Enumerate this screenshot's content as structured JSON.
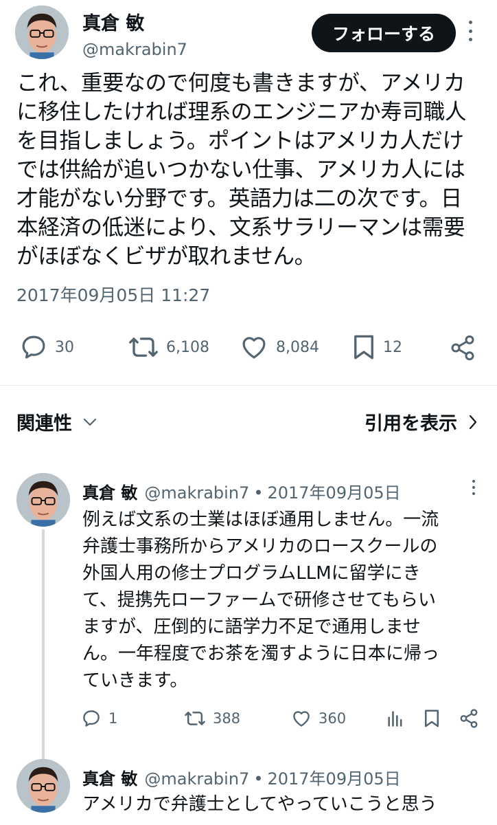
{
  "tweet": {
    "author_name": "真倉 敏",
    "author_handle": "@makrabin7",
    "follow_label": "フォローする",
    "text": "これ、重要なので何度も書きますが、アメリカ\nに移住したければ理系のエンジニアか寿司職人\nを目指しましょう。ポイントはアメリカ人だけ\nでは供給が追いつかない仕事、アメリカ人には\n才能がない分野です。英語力は二の次です。日\n本経済の低迷により、文系サラリーマンは需要\nがほぼなくビザが取れません。",
    "timestamp": "2017年09月05日 11:27",
    "stats": {
      "replies": "30",
      "retweets": "6,108",
      "likes": "8,084",
      "bookmarks": "12"
    }
  },
  "section": {
    "related_label": "関連性",
    "quotes_label": "引用を表示"
  },
  "replies": [
    {
      "author_name": "真倉 敏",
      "author_handle": "@makrabin7",
      "separator": "•",
      "date": "2017年09月05日",
      "text": "例えば文系の士業はほぼ通用しません。一流\n弁護士事務所からアメリカのロースクールの\n外国人用の修士プログラムLLMに留学にき\nて、提携先ローファームで研修させてもらい\nますが、圧倒的に語学力不足で通用しませ\nん。一年程度でお茶を濁すように日本に帰っ\nていきます。",
      "stats": {
        "replies": "1",
        "retweets": "388",
        "likes": "360"
      }
    },
    {
      "author_name": "真倉 敏",
      "author_handle": "@makrabin7",
      "separator": "•",
      "date": "2017年09月05日",
      "text": "アメリカで弁護士としてやっていこうと思う"
    }
  ],
  "icons": {
    "reply": "comment-icon",
    "retweet": "retweet-icon",
    "like": "heart-icon",
    "bookmark": "bookmark-icon",
    "share": "share-icon",
    "views": "bar-chart-icon",
    "more": "more-dots-icon"
  },
  "colors": {
    "text": "#0f1419",
    "secondary": "#536471",
    "button_bg": "#0f1419",
    "divider": "#e6ecf0"
  }
}
